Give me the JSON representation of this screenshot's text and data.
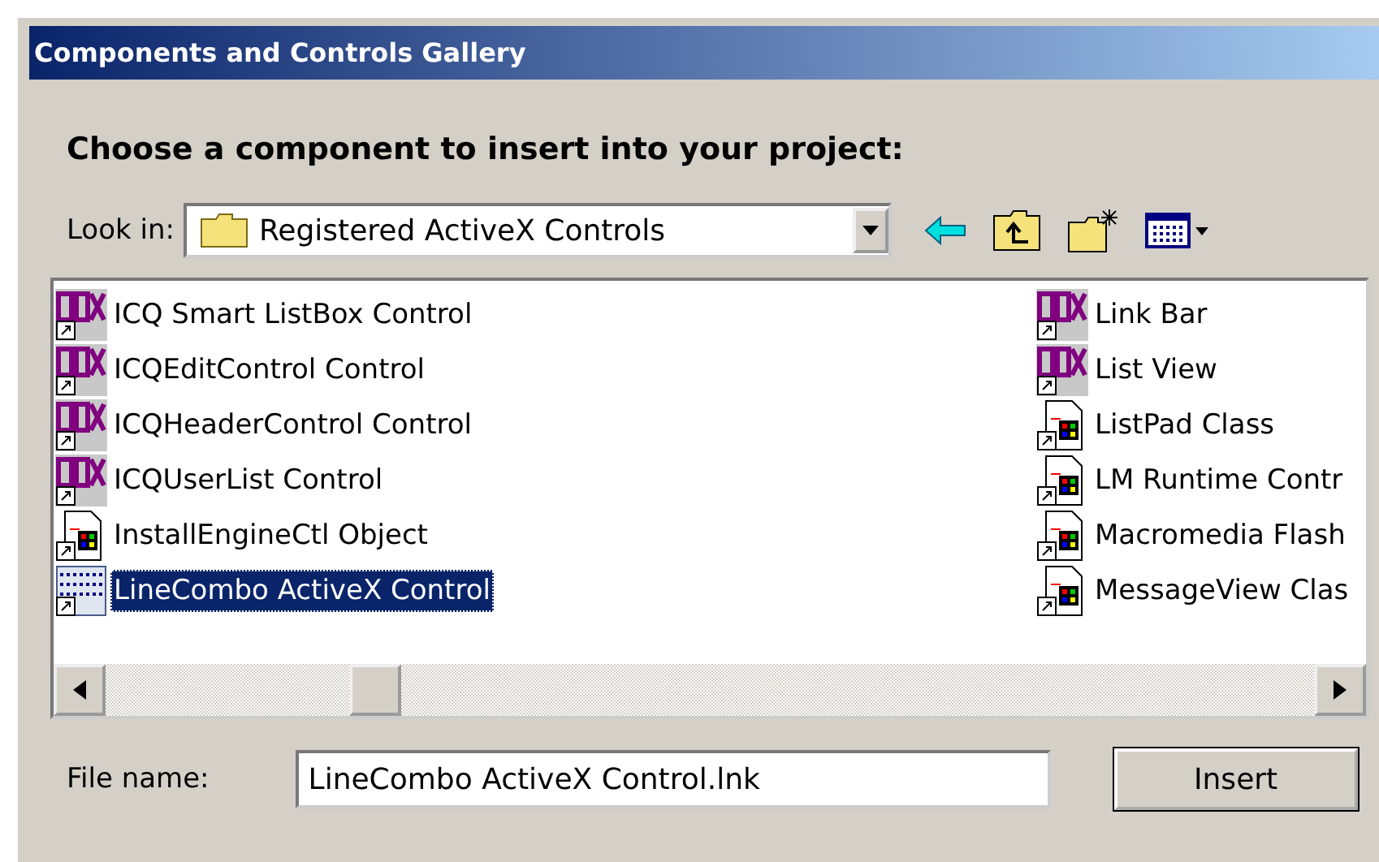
{
  "window": {
    "title": "Components and Controls Gallery"
  },
  "prompt": "Choose a component to insert into your project:",
  "look_in": {
    "label": "Look in:",
    "value": "Registered ActiveX Controls"
  },
  "items": [
    {
      "label": "ICQ Smart ListBox Control",
      "kind": "ocx",
      "selected": false
    },
    {
      "label": "ICQEditControl Control",
      "kind": "ocx",
      "selected": false
    },
    {
      "label": "ICQHeaderControl Control",
      "kind": "ocx",
      "selected": false
    },
    {
      "label": "ICQUserList Control",
      "kind": "ocx",
      "selected": false
    },
    {
      "label": "InstallEngineCtl Object",
      "kind": "doc",
      "selected": false
    },
    {
      "label": "LineCombo ActiveX Control",
      "kind": "combo",
      "selected": true
    },
    {
      "label": "Link Bar",
      "kind": "ocx",
      "selected": false
    },
    {
      "label": "List View",
      "kind": "ocx",
      "selected": false
    },
    {
      "label": "ListPad Class",
      "kind": "doc",
      "selected": false
    },
    {
      "label": "LM Runtime Contr",
      "kind": "doc",
      "selected": false
    },
    {
      "label": "Macromedia Flash",
      "kind": "doc",
      "selected": false
    },
    {
      "label": "MessageView Clas",
      "kind": "doc",
      "selected": false
    }
  ],
  "file_name": {
    "label": "File name:",
    "value": "LineCombo ActiveX Control.lnk"
  },
  "buttons": [
    "Insert"
  ]
}
